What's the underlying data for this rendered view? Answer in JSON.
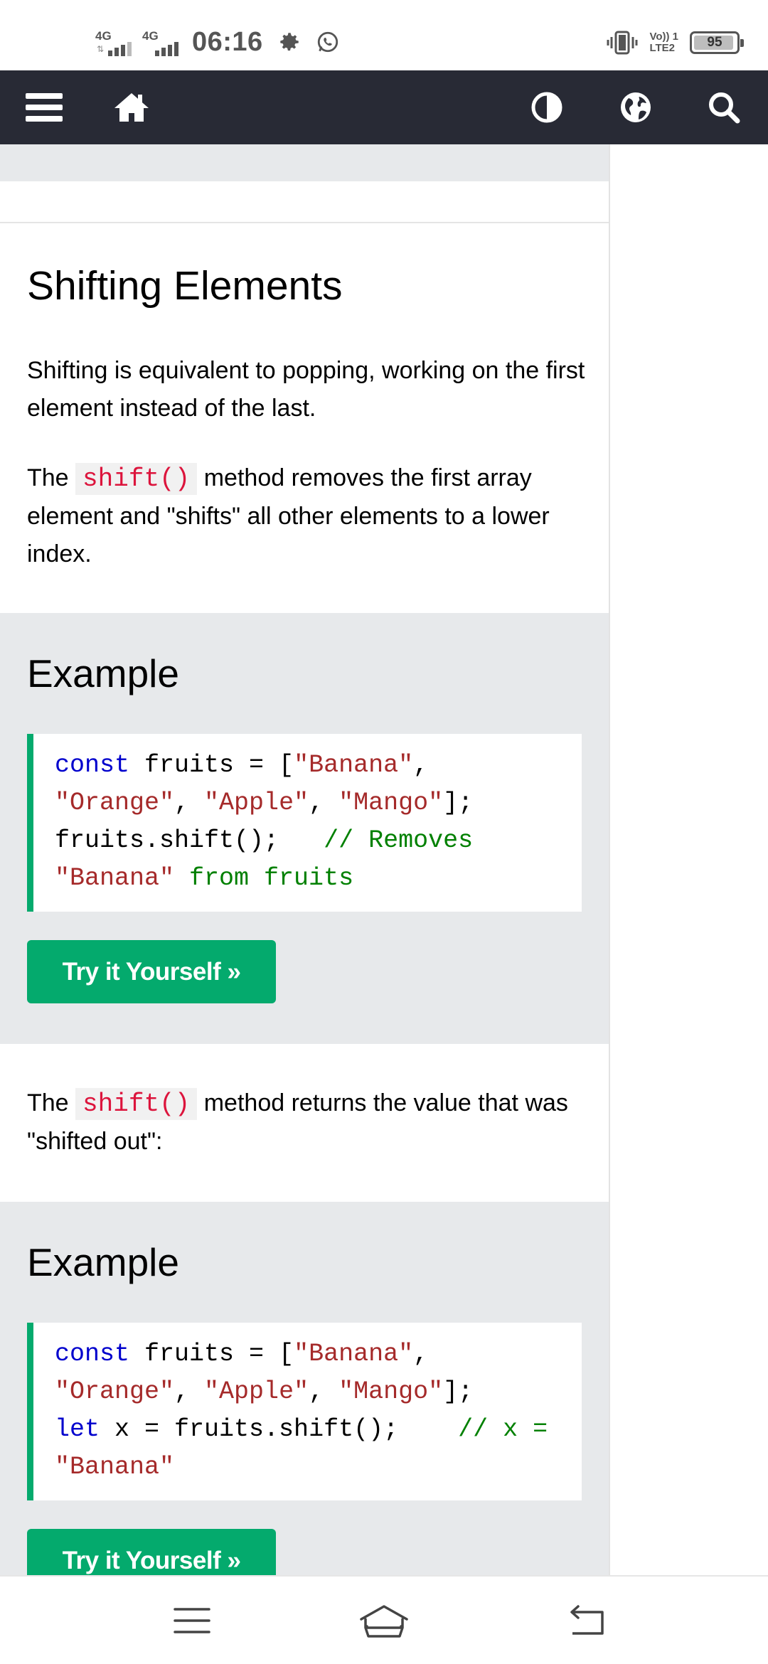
{
  "status_bar": {
    "sim1_network": "4G",
    "sim2_network": "4G",
    "time": "06:16",
    "volte_line1": "Vo)) 1",
    "volte_line2": "LTE2",
    "battery_percent": "95",
    "battery_level": 0.95
  },
  "topnav": {
    "icons": [
      "menu-icon",
      "home-icon",
      "contrast-icon",
      "globe-icon",
      "search-icon"
    ],
    "background": "#282a35"
  },
  "content": {
    "heading": "Shifting Elements",
    "intro": "Shifting is equivalent to popping, working on the first element instead of the last.",
    "p2_before": "The",
    "p2_code": "shift()",
    "p2_after": "method removes the first array element and \"shifts\" all other elements to a lower index.",
    "example1": {
      "title": "Example",
      "code_lines": [
        [
          "const",
          " fruits = [",
          "\"Banana\"",
          ","
        ],
        [
          "\"Orange\"",
          ", ",
          "\"Apple\"",
          ", ",
          "\"Mango\"",
          "];"
        ],
        [
          "fruits.shift();   ",
          "// Removes"
        ],
        [
          "\"Banana\" from fruits"
        ]
      ],
      "button": "Try it Yourself »"
    },
    "p3_before": "The",
    "p3_code": "shift()",
    "p3_after": "method returns the value that was \"shifted out\":",
    "example2": {
      "title": "Example",
      "button": "Try it Yourself »"
    }
  },
  "colors": {
    "accent_green": "#04aa6d",
    "code_keyword": "#0000cd",
    "code_string": "#a52a2a",
    "code_comment": "#008000",
    "inline_code": "#dc143c"
  },
  "system_nav": {
    "icons": [
      "recent-apps-icon",
      "home-icon",
      "back-icon"
    ]
  }
}
